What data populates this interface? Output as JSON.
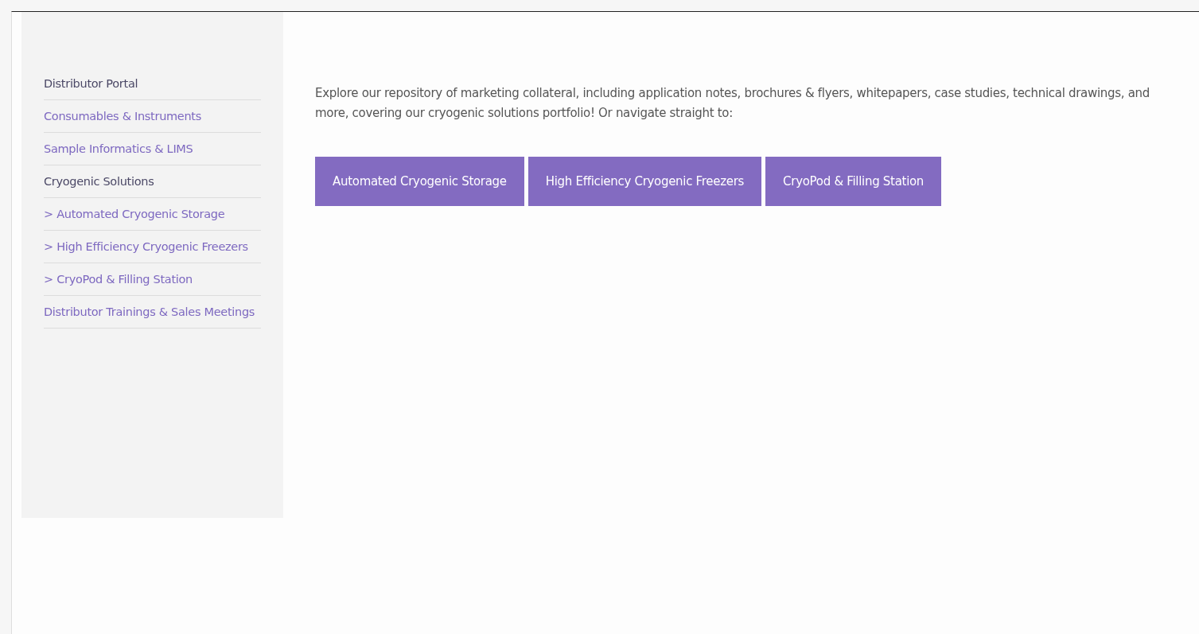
{
  "sidebar": {
    "items": [
      {
        "label": "Distributor Portal",
        "selected": true
      },
      {
        "label": "Consumables & Instruments",
        "selected": false
      },
      {
        "label": "Sample Informatics & LIMS",
        "selected": false
      },
      {
        "label": "Cryogenic Solutions",
        "selected": true
      },
      {
        "label": "> Automated Cryogenic Storage",
        "selected": false
      },
      {
        "label": "> High Efficiency Cryogenic Freezers",
        "selected": false
      },
      {
        "label": "> CryoPod & Filling Station",
        "selected": false
      },
      {
        "label": "Distributor Trainings & Sales Meetings",
        "selected": false
      }
    ]
  },
  "content": {
    "intro": "Explore our repository of marketing collateral, including application notes, brochures & flyers, whitepapers, case studies, technical drawings, and more, covering our cryogenic solutions portfolio! Or navigate straight to:",
    "buttons": [
      "Automated Cryogenic Storage",
      "High Efficiency Cryogenic Freezers",
      "CryoPod & Filling Station"
    ]
  }
}
